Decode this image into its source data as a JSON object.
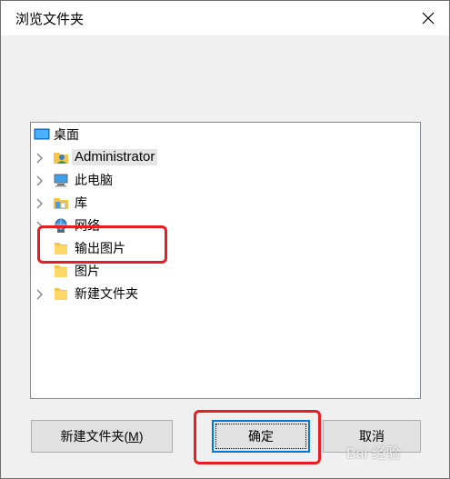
{
  "dialog": {
    "title": "浏览文件夹"
  },
  "tree": {
    "items": [
      {
        "label": "桌面",
        "icon": "desktop-icon",
        "expander": false
      },
      {
        "label": "Administrator",
        "icon": "user-folder-icon",
        "expander": true,
        "selected": true
      },
      {
        "label": "此电脑",
        "icon": "computer-icon",
        "expander": true
      },
      {
        "label": "库",
        "icon": "library-icon",
        "expander": true
      },
      {
        "label": "网络",
        "icon": "network-icon",
        "expander": true
      },
      {
        "label": "输出图片",
        "icon": "folder-icon",
        "expander": false
      },
      {
        "label": "图片",
        "icon": "folder-icon",
        "expander": false
      },
      {
        "label": "新建文件夹",
        "icon": "folder-icon",
        "expander": true
      }
    ]
  },
  "buttons": {
    "new_folder": "新建文件夹(M)",
    "new_folder_prefix": "新建文件夹(",
    "new_folder_key": "M",
    "new_folder_suffix": ")",
    "ok": "确定",
    "cancel": "取消"
  },
  "watermark": {
    "text": "Bai 经验"
  },
  "colors": {
    "highlight": "#e81c23",
    "accent": "#0078d7",
    "folder": "#f5c64a"
  }
}
